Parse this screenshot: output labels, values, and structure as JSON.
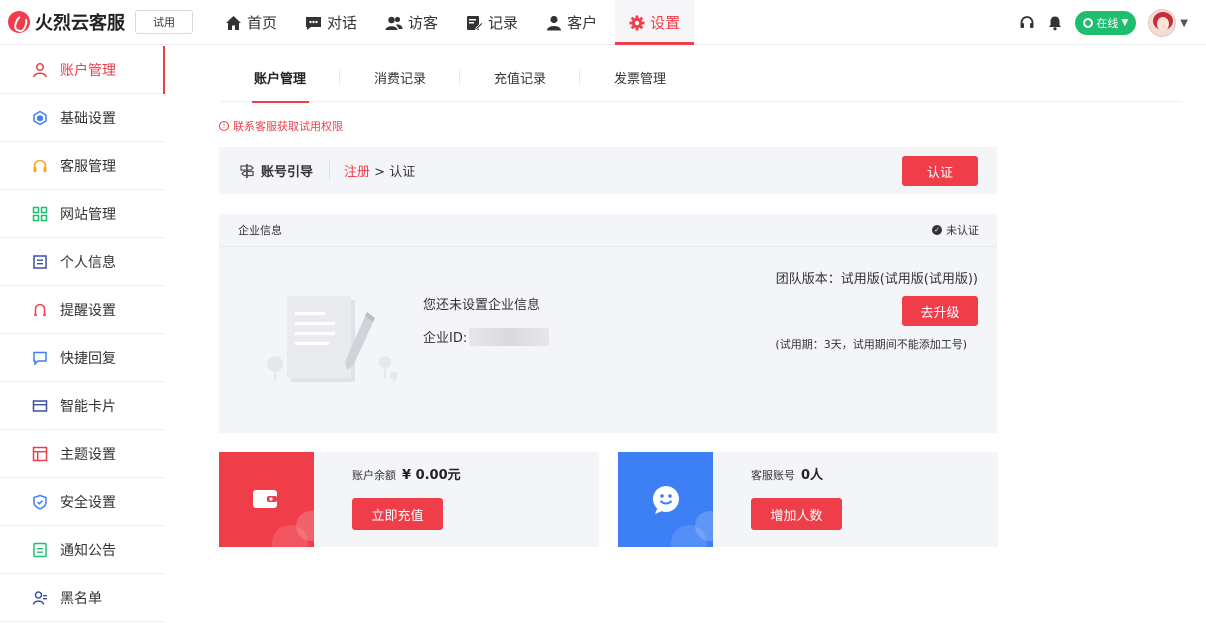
{
  "brand": {
    "name": "火烈云客服",
    "trial_label": "试用"
  },
  "nav": [
    {
      "label": "首页",
      "icon": "home-icon"
    },
    {
      "label": "对话",
      "icon": "chat-icon"
    },
    {
      "label": "访客",
      "icon": "visitors-icon"
    },
    {
      "label": "记录",
      "icon": "records-icon"
    },
    {
      "label": "客户",
      "icon": "customer-icon"
    },
    {
      "label": "设置",
      "icon": "gear-icon",
      "active": true
    }
  ],
  "topright": {
    "status": "在线"
  },
  "sidebar": [
    {
      "label": "账户管理",
      "icon": "user-icon",
      "active": true
    },
    {
      "label": "基础设置",
      "icon": "hexagon-icon"
    },
    {
      "label": "客服管理",
      "icon": "headset-icon"
    },
    {
      "label": "网站管理",
      "icon": "grid-icon"
    },
    {
      "label": "个人信息",
      "icon": "profile-card-icon"
    },
    {
      "label": "提醒设置",
      "icon": "bell-icon"
    },
    {
      "label": "快捷回复",
      "icon": "message-icon"
    },
    {
      "label": "智能卡片",
      "icon": "card-icon"
    },
    {
      "label": "主题设置",
      "icon": "theme-icon"
    },
    {
      "label": "安全设置",
      "icon": "shield-icon"
    },
    {
      "label": "通知公告",
      "icon": "notice-icon"
    },
    {
      "label": "黑名单",
      "icon": "blacklist-icon"
    }
  ],
  "tabs": [
    "账户管理",
    "消费记录",
    "充值记录",
    "发票管理"
  ],
  "notice": "联系客服获取试用权限",
  "guide": {
    "title": "账号引导",
    "step_current": "注册",
    "step_sep": " > ",
    "step_next": "认证",
    "button": "认证"
  },
  "company": {
    "header": "企业信息",
    "status": "未认证",
    "empty_title": "您还未设置企业信息",
    "id_label": "企业ID:",
    "version": "团队版本：试用版(试用版(试用版))",
    "upgrade_button": "去升级",
    "trial_note": "(试用期：3天，试用期间不能添加工号)"
  },
  "balance": {
    "label": "账户余额",
    "value": "¥ 0.00元",
    "button": "立即充值"
  },
  "agents": {
    "label": "客服账号",
    "value": "0人",
    "button": "增加人数"
  },
  "colors": {
    "accent": "#ef3e4a",
    "online": "#1dbf6f",
    "agent_card": "#3d7ff5"
  }
}
